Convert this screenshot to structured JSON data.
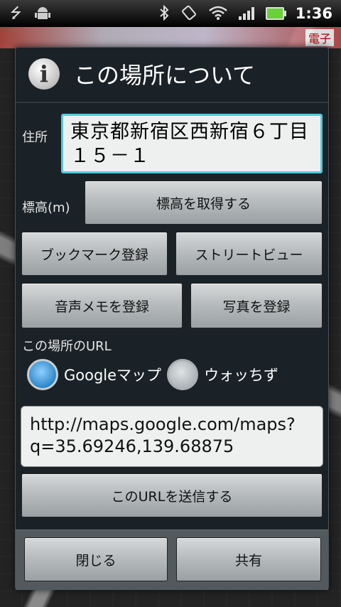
{
  "status_bar": {
    "time": "1:36",
    "icons": [
      "usb-icon",
      "android-debug-icon",
      "bluetooth-icon",
      "rotate-icon",
      "wifi-icon",
      "signal-icon",
      "battery-icon"
    ]
  },
  "map": {
    "label": "電子"
  },
  "dialog": {
    "title": "この場所について",
    "address_label": "住所",
    "address_value": "東京都新宿区西新宿６丁目１５－１",
    "elevation_label": "標高(m)",
    "get_elevation_button": "標高を取得する",
    "bookmark_button": "ブックマーク登録",
    "street_view_button": "ストリートビュー",
    "voice_memo_button": "音声メモを登録",
    "photo_button": "写真を登録",
    "url_section_label": "この場所のURL",
    "radio_options": [
      {
        "label": "Googleマップ",
        "selected": true
      },
      {
        "label": "ウォッちず",
        "selected": false
      }
    ],
    "url_value": "http://maps.google.com/maps?q=35.69246,139.68875",
    "send_url_button": "このURLを送信する",
    "close_button": "閉じる",
    "share_button": "共有"
  },
  "colors": {
    "dialog_bg": "#1b2227",
    "focus_border": "#58c7e0",
    "radio_selected": "#2e86c8"
  }
}
